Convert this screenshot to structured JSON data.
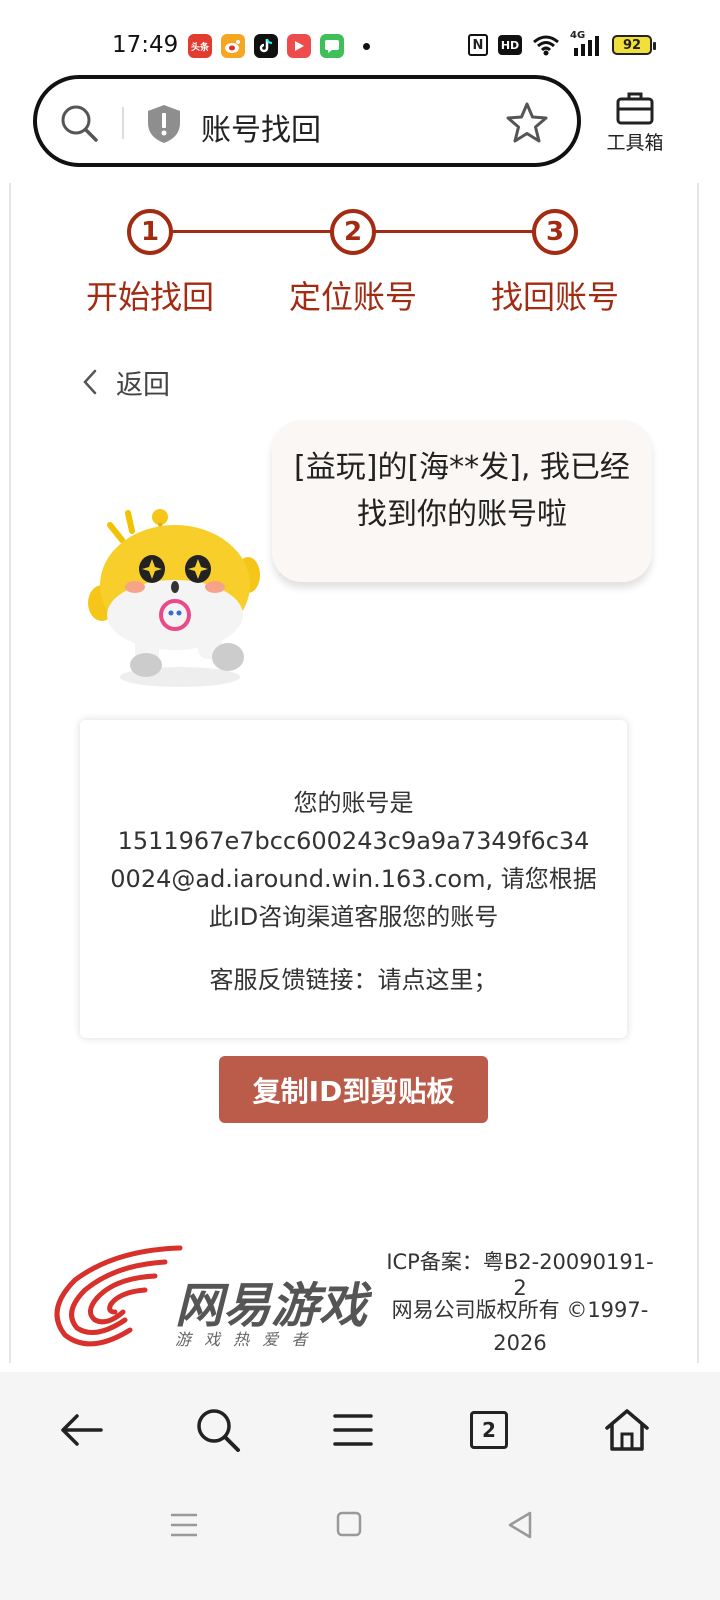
{
  "status_bar": {
    "time": "17:49",
    "apps": [
      {
        "name": "toutiao-icon",
        "color": "#e33b30",
        "label": "头条"
      },
      {
        "name": "weibo-icon",
        "color": "#f5a623",
        "label": ""
      },
      {
        "name": "tiktok-icon",
        "color": "#111111",
        "label": ""
      },
      {
        "name": "video-icon",
        "color": "#ee4c4c",
        "label": ""
      },
      {
        "name": "messages-icon",
        "color": "#3fbf5a",
        "label": ""
      }
    ],
    "hd_label": "HD",
    "network_label": "4G",
    "battery": "92"
  },
  "address_bar": {
    "title": "账号找回"
  },
  "toolbox": {
    "label": "工具箱"
  },
  "steps": [
    {
      "number": "1",
      "label": "开始找回"
    },
    {
      "number": "2",
      "label": "定位账号"
    },
    {
      "number": "3",
      "label": "找回账号"
    }
  ],
  "back": {
    "label": "返回"
  },
  "bubble": {
    "text": "[益玩]的[海**发], 我已经找到你的账号啦"
  },
  "card": {
    "intro": "您的账号是",
    "text": "1511967e7bcc600243c9a9a7349f6c340024@ad.iaround.win.163.com, 请您根据此ID咨询渠道客服您的账号",
    "link_text": "客服反馈链接：请点这里；"
  },
  "copy_button": {
    "label": "复制ID到剪贴板"
  },
  "footer": {
    "logo_text": "网易游戏",
    "logo_slogan": "游 戏 热 爱 者",
    "icp": "ICP备案：粤B2-20090191-2",
    "copyright": "网易公司版权所有 ©1997-2026"
  },
  "bottom_bar": {
    "tabs_count": "2"
  },
  "colors": {
    "accent": "#a32b12",
    "button": "#bb5c4b",
    "logo_red": "#d8302a"
  }
}
